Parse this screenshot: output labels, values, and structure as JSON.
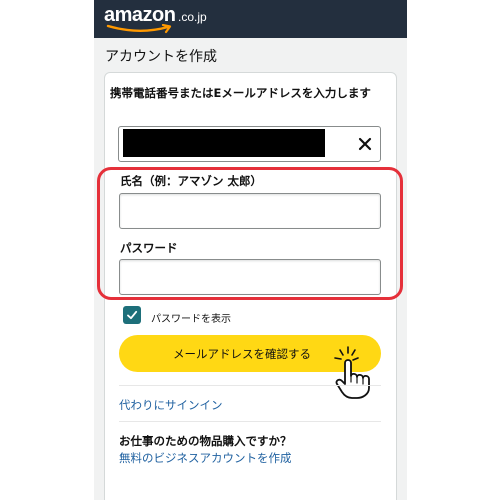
{
  "header": {
    "logo_word": "amazon",
    "logo_suffix": ".co.jp"
  },
  "page": {
    "title": "アカウントを作成"
  },
  "form": {
    "contact_label": "携帯電話番号またはEメールアドレスを入力します",
    "contact_value": "",
    "name_label": "氏名（例：アマゾン 太郎）",
    "name_value": "",
    "password_label": "パスワード",
    "password_value": "",
    "show_password_label": "パスワードを表示",
    "show_password_checked": true,
    "submit_label": "メールアドレスを確認する"
  },
  "links": {
    "signin_instead": "代わりにサインイン",
    "business_question": "お仕事のための物品購入ですか？",
    "business_link": "無料のビジネスアカウントを作成"
  },
  "colors": {
    "header_bg": "#232f3e",
    "button_yellow": "#ffd814",
    "link_blue": "#2162a1",
    "checkbox_teal": "#1d6f7a",
    "highlight_red": "#e5303a"
  },
  "icons": {
    "clear": "close-icon",
    "check": "check-icon",
    "pointer": "pointing-hand-icon"
  }
}
